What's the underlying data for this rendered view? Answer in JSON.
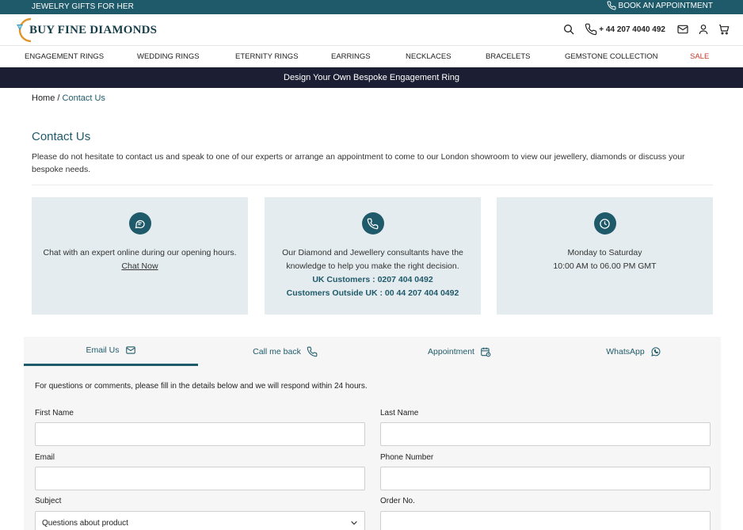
{
  "topbar": {
    "promo": "JEWELRY GIFTS FOR HER",
    "appointment": "BOOK AN APPOINTMENT"
  },
  "header": {
    "logo_text": "BUY FINE DIAMONDS",
    "phone": "+ 44 207 4040 492",
    "icons": [
      "search-icon",
      "phone-icon",
      "mail-icon",
      "user-icon",
      "cart-icon"
    ]
  },
  "nav": {
    "items": [
      "ENGAGEMENT RINGS",
      "WEDDING RINGS",
      "ETERNITY RINGS",
      "EARRINGS",
      "NECKLACES",
      "BRACELETS",
      "GEMSTONE COLLECTION",
      "SALE"
    ]
  },
  "banner": {
    "text": "Design Your Own Bespoke Engagement Ring"
  },
  "breadcrumb": {
    "home": "Home",
    "separator": " / ",
    "current": "Contact Us"
  },
  "page": {
    "title": "Contact Us",
    "intro": "Please do not hesitate to contact us and speak to one of our experts or arrange an appointment to come to our London showroom to view our jewellery, diamonds or discuss your bespoke needs."
  },
  "cards": [
    {
      "icon": "chat-icon",
      "text": "Chat with an expert online during our opening hours.",
      "link": "Chat Now"
    },
    {
      "icon": "phone-icon",
      "text": "Our Diamond and Jewellery consultants have the knowledge to help you make the right decision.",
      "line1": "UK Customers : 0207 404 0492",
      "line2": "Customers Outside UK : 00 44 207 404 0492"
    },
    {
      "icon": "clock-icon",
      "line1": "Monday to Saturday",
      "line2": "10:00 AM to 06.00 PM GMT"
    }
  ],
  "tabs": [
    {
      "label": "Email Us",
      "icon": "mail-icon",
      "active": true
    },
    {
      "label": "Call me back",
      "icon": "phone-icon",
      "active": false
    },
    {
      "label": "Appointment",
      "icon": "calendar-icon",
      "active": false
    },
    {
      "label": "WhatsApp",
      "icon": "whatsapp-icon",
      "active": false
    }
  ],
  "form": {
    "note": "For questions or comments, please fill in the details below and we will respond within 24 hours.",
    "first_name_label": "First Name",
    "first_name_value": "",
    "last_name_label": "Last Name",
    "last_name_value": "",
    "email_label": "Email",
    "email_value": "",
    "phone_label": "Phone Number",
    "phone_value": "",
    "subject_label": "Subject",
    "subject_value": "Questions about product",
    "order_label": "Order No.",
    "order_value": ""
  },
  "colors": {
    "brand": "#1f5a6a",
    "banner": "#1c1f33",
    "card_bg": "#e4ecef",
    "sale": "#c8392b",
    "logo_gold": "#e0962a"
  }
}
